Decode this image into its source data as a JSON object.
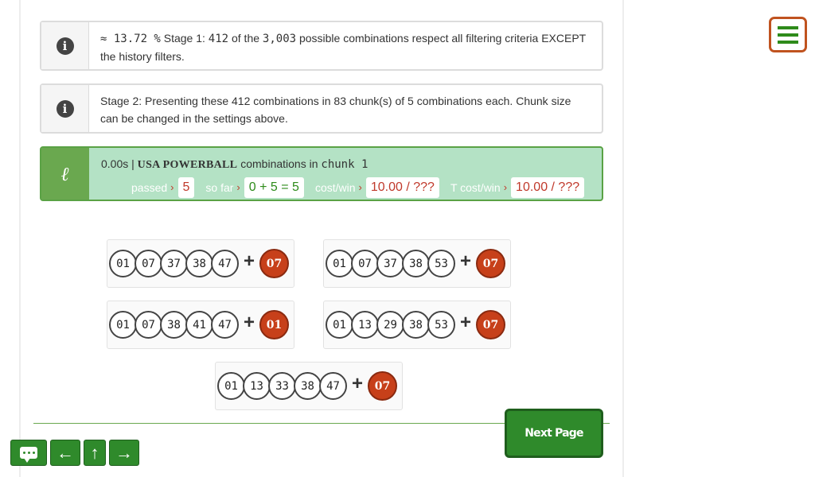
{
  "stage1": {
    "approx": "≈ 13.72 %",
    "prefix": " Stage 1: ",
    "count": "412",
    "mid": " of the ",
    "total": "3,003",
    "suffix": " possible combinations respect all filtering criteria EXCEPT the history filters."
  },
  "stage2": {
    "text": "Stage 2: Presenting these 412 combinations in 83 chunk(s) of 5 combinations each. Chunk size can be changed in the settings above."
  },
  "chunk": {
    "time": "0.00s | ",
    "game": "USA POWERBALL",
    "mid": " combinations in ",
    "chunk_label": "chunk 1",
    "passed_label": "passed",
    "passed_value": "5",
    "sofar_label": "so far",
    "sofar_value": "0 + 5 = 5",
    "costwin_label": "cost/win",
    "costwin_value": "10.00 / ???",
    "tcostwin_label": "T cost/win",
    "tcostwin_value": "10.00 / ???"
  },
  "combinations": [
    {
      "balls": [
        "01",
        "07",
        "37",
        "38",
        "47"
      ],
      "powerball": "07"
    },
    {
      "balls": [
        "01",
        "07",
        "37",
        "38",
        "53"
      ],
      "powerball": "07"
    },
    {
      "balls": [
        "01",
        "07",
        "38",
        "41",
        "47"
      ],
      "powerball": "01"
    },
    {
      "balls": [
        "01",
        "13",
        "29",
        "38",
        "53"
      ],
      "powerball": "07"
    },
    {
      "balls": [
        "01",
        "13",
        "33",
        "38",
        "47"
      ],
      "powerball": "07"
    }
  ],
  "plus_sign": "+",
  "next_button": "Next Page",
  "nav": {
    "back": "←",
    "up": "↑",
    "forward": "→"
  },
  "icons": {
    "info": "i",
    "stage_marker": "ℓ"
  },
  "colors": {
    "accent_green": "#2f8a2b",
    "powerball_red": "#c7401a",
    "menu_border": "#c0531f",
    "stage_box_bg": "#b4e2c5"
  }
}
